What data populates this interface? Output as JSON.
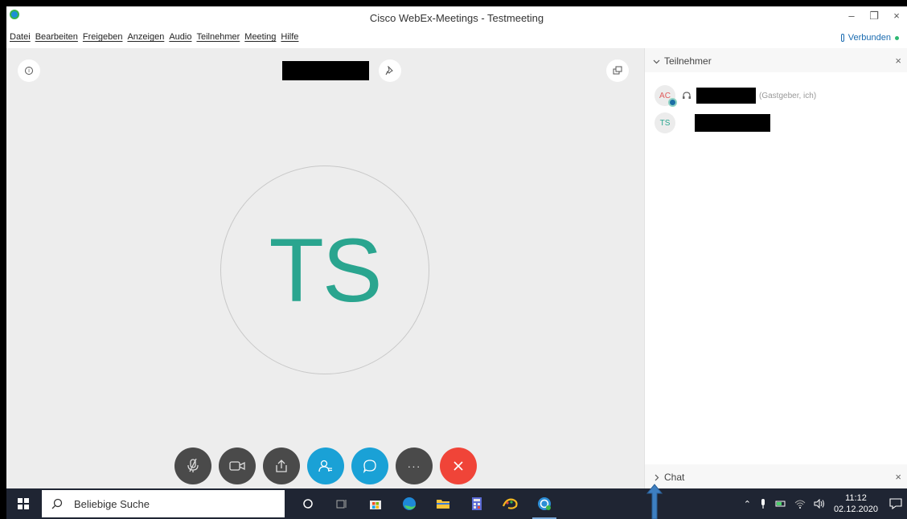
{
  "window": {
    "title": "Cisco WebEx-Meetings - Testmeeting",
    "controls": {
      "minimize": "–",
      "restore": "❐",
      "close": "×"
    }
  },
  "menubar": {
    "items": [
      "Datei",
      "Bearbeiten",
      "Freigeben",
      "Anzeigen",
      "Audio",
      "Teilnehmer",
      "Meeting",
      "Hilfe"
    ],
    "status": "Verbunden"
  },
  "stage": {
    "avatar_initials": "TS"
  },
  "controls": {
    "more": "···"
  },
  "participants_panel": {
    "title": "Teilnehmer",
    "close": "×",
    "items": [
      {
        "initials": "AC",
        "role_label": "(Gastgeber, ich)"
      },
      {
        "initials": "TS",
        "role_label": ""
      }
    ]
  },
  "chat_panel": {
    "title": "Chat",
    "close": "×"
  },
  "taskbar": {
    "search_placeholder": "Beliebige Suche",
    "time": "11:12",
    "date": "02.12.2020"
  },
  "colors": {
    "accent_blue": "#1aa1d6",
    "end_red": "#f04438",
    "avatar_teal": "#2aa58f",
    "taskbar": "#1f2533"
  }
}
